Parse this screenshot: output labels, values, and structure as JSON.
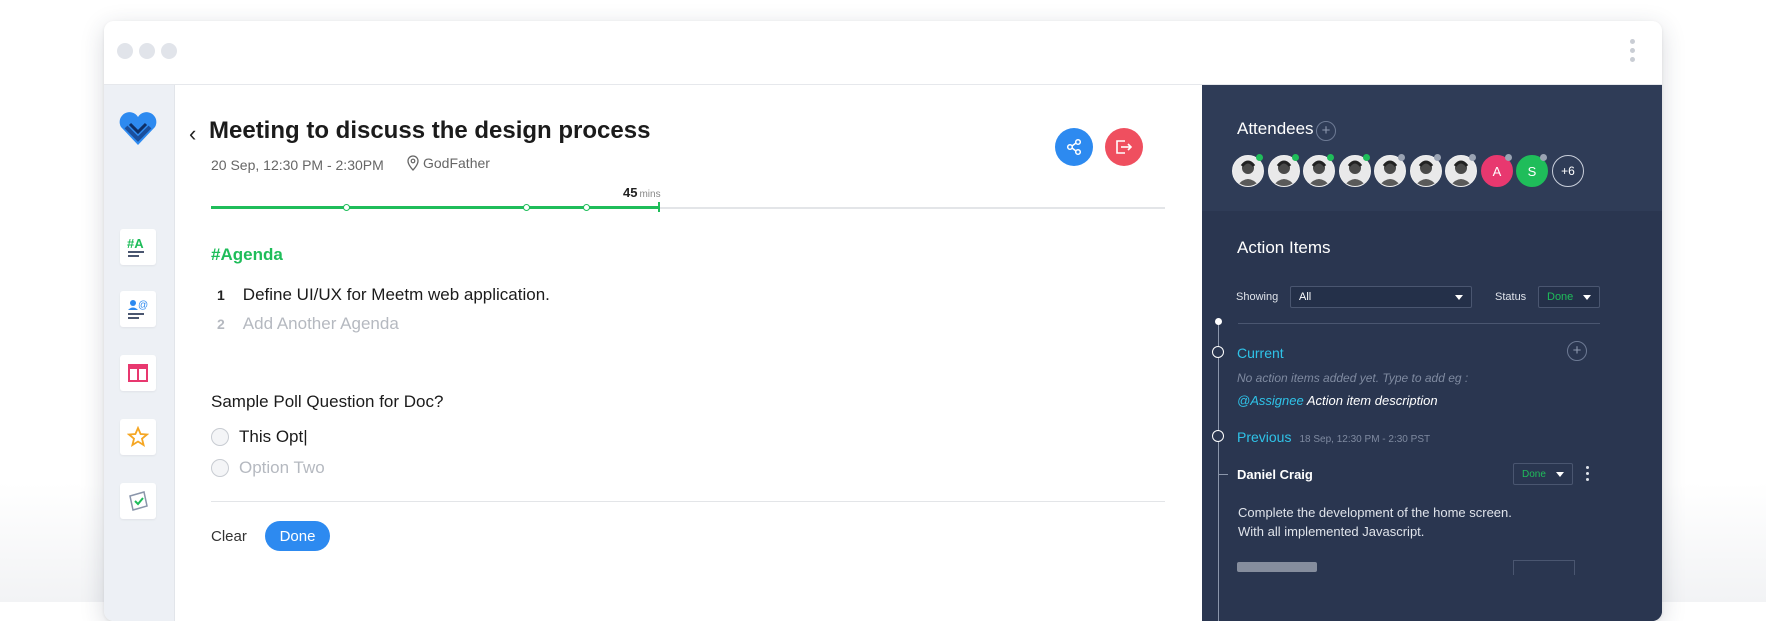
{
  "meeting": {
    "title": "Meeting to discuss the design process",
    "datetime": "20 Sep, 12:30 PM - 2:30PM",
    "location": "GodFather",
    "progress_minutes": "45",
    "progress_unit": "mins",
    "progress_fraction": 0.47
  },
  "agenda": {
    "heading": "#Agenda",
    "items": [
      {
        "num": "1",
        "text": "Define UI/UX for Meetm web application."
      },
      {
        "num": "2",
        "text": "Add Another Agenda"
      }
    ]
  },
  "poll": {
    "question": "Sample Poll Question for Doc?",
    "option_one": "This Opt|",
    "option_two_placeholder": "Option Two",
    "clear_label": "Clear",
    "done_label": "Done"
  },
  "attendees": {
    "title": "Attendees",
    "add_icon": "plus-circle-icon",
    "avatars": [
      {
        "type": "photo",
        "status": "#1fbd5a"
      },
      {
        "type": "photo",
        "status": "#1fbd5a"
      },
      {
        "type": "photo",
        "status": "#1fbd5a"
      },
      {
        "type": "photo",
        "status": "#1fbd5a"
      },
      {
        "type": "photo",
        "status": "#9aa3b3"
      },
      {
        "type": "photo",
        "status": "#9aa3b3"
      },
      {
        "type": "photo",
        "status": "#9aa3b3"
      },
      {
        "type": "letter",
        "letter": "A",
        "bg": "#e8386f",
        "status": "#9aa3b3"
      },
      {
        "type": "letter",
        "letter": "S",
        "bg": "#1fbd5a",
        "status": "#9aa3b3"
      }
    ],
    "more": "+6"
  },
  "action_items": {
    "title": "Action Items",
    "showing_label": "Showing",
    "showing_value": "All",
    "status_label": "Status",
    "status_value": "Done",
    "current": {
      "label": "Current",
      "empty_hint": "No action items added yet. Type to add eg :",
      "example_assignee": "@Assignee",
      "example_description": "Action item description"
    },
    "previous": {
      "label": "Previous",
      "date": "18 Sep, 12:30 PM - 2:30 PST"
    },
    "entries": [
      {
        "assignee": "Daniel Craig",
        "status": "Done",
        "line1": "Complete the development of the home screen.",
        "line2": "With all implemented Javascript."
      }
    ]
  },
  "colors": {
    "accent_green": "#1fbd5a",
    "share_blue": "#2d8af0",
    "exit_red": "#ef4f5f",
    "panel_navy": "#2f3c57",
    "cyan": "#2fc3e8"
  }
}
